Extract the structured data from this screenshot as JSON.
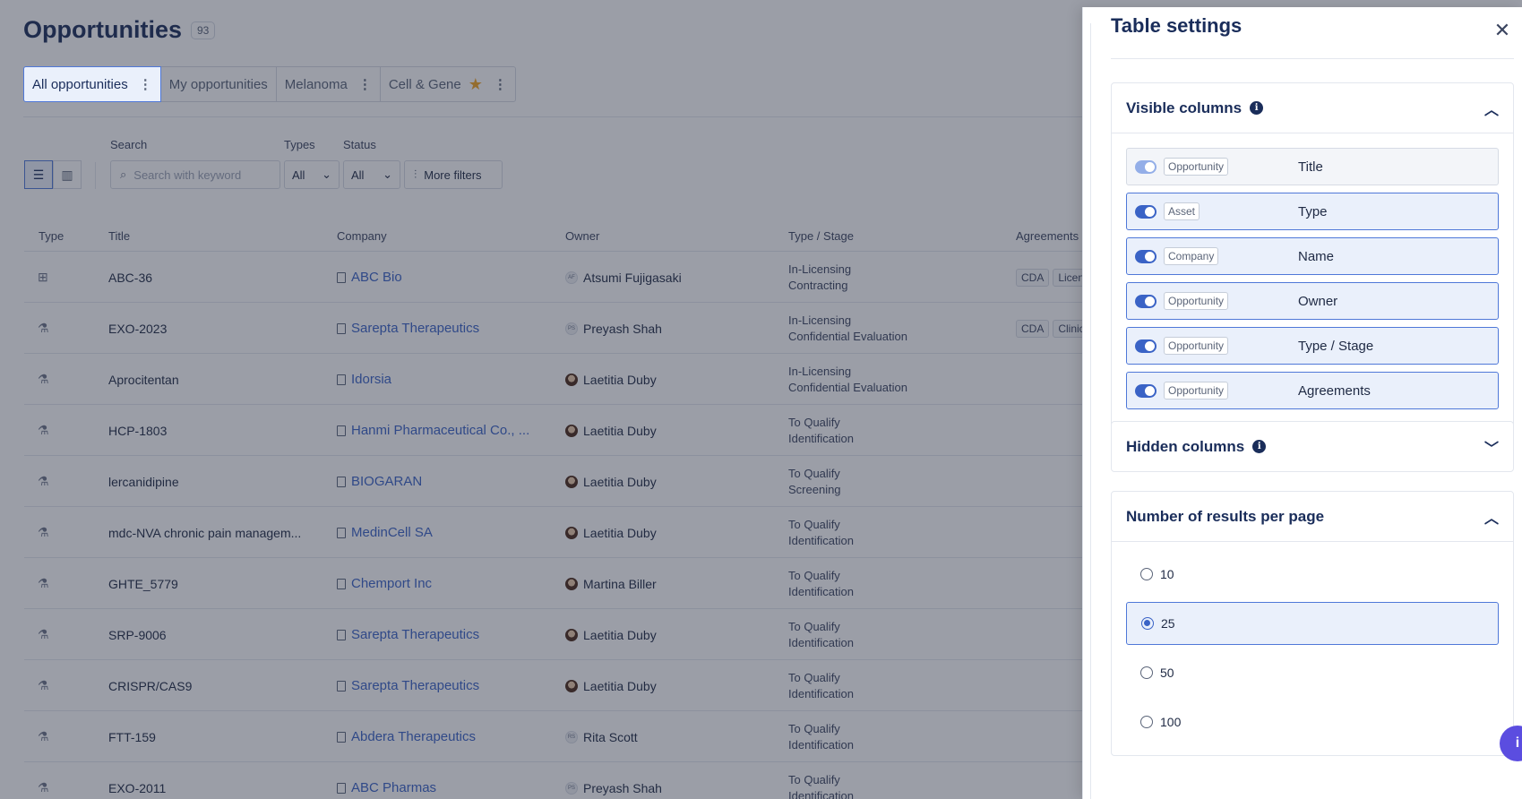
{
  "page": {
    "title": "Opportunities",
    "count": "93"
  },
  "views": [
    {
      "label": "All opportunities"
    },
    {
      "label": "My opportunities"
    },
    {
      "label": "Melanoma"
    },
    {
      "label": "Cell & Gene"
    }
  ],
  "filters": {
    "search_label": "Search",
    "search_placeholder": "Search with keyword",
    "types_label": "Types",
    "types_value": "All",
    "status_label": "Status",
    "status_value": "All",
    "more_filters": "More filters"
  },
  "table": {
    "headers": {
      "type": "Type",
      "title": "Title",
      "company": "Company",
      "owner": "Owner",
      "type_stage": "Type / Stage",
      "agreements": "Agreements"
    },
    "rows": [
      {
        "icon": "grid-icon",
        "title": "ABC-36",
        "company": "ABC Bio",
        "owner": "Atsumi Fujigasaki",
        "owner_initials": "AF",
        "type": "In-Licensing",
        "stage": "Contracting",
        "agreements": [
          "CDA",
          "Licens"
        ]
      },
      {
        "icon": "flask-icon",
        "title": "EXO-2023",
        "company": "Sarepta Therapeutics",
        "owner": "Preyash Shah",
        "owner_initials": "PS",
        "type": "In-Licensing",
        "stage": "Confidential Evaluation",
        "agreements": [
          "CDA",
          "Clinica"
        ]
      },
      {
        "icon": "flask-icon",
        "title": "Aprocitentan",
        "company": "Idorsia",
        "owner": "Laetitia Duby",
        "owner_initials": "",
        "type": "In-Licensing",
        "stage": "Confidential Evaluation",
        "agreements": []
      },
      {
        "icon": "flask-icon",
        "title": "HCP-1803",
        "company": "Hanmi Pharmaceutical Co., ...",
        "owner": "Laetitia Duby",
        "owner_initials": "",
        "type": "To Qualify",
        "stage": "Identification",
        "agreements": []
      },
      {
        "icon": "flask-icon",
        "title": "lercanidipine",
        "company": "BIOGARAN",
        "owner": "Laetitia Duby",
        "owner_initials": "",
        "type": "To Qualify",
        "stage": "Screening",
        "agreements": []
      },
      {
        "icon": "flask-icon",
        "title": "mdc-NVA chronic pain managem...",
        "company": "MedinCell SA",
        "owner": "Laetitia Duby",
        "owner_initials": "",
        "type": "To Qualify",
        "stage": "Identification",
        "agreements": []
      },
      {
        "icon": "flask-icon",
        "title": "GHTE_5779",
        "company": "Chemport Inc",
        "owner": "Martina Biller",
        "owner_initials": "",
        "type": "To Qualify",
        "stage": "Identification",
        "agreements": []
      },
      {
        "icon": "flask-icon",
        "title": "SRP-9006",
        "company": "Sarepta Therapeutics",
        "owner": "Laetitia Duby",
        "owner_initials": "",
        "type": "To Qualify",
        "stage": "Identification",
        "agreements": []
      },
      {
        "icon": "flask-icon",
        "title": "CRISPR/CAS9",
        "company": "Sarepta Therapeutics",
        "owner": "Laetitia Duby",
        "owner_initials": "",
        "type": "To Qualify",
        "stage": "Identification",
        "agreements": []
      },
      {
        "icon": "flask-icon",
        "title": "FTT-159",
        "company": "Abdera Therapeutics",
        "owner": "Rita Scott",
        "owner_initials": "RS",
        "type": "To Qualify",
        "stage": "Identification",
        "agreements": []
      },
      {
        "icon": "flask-icon",
        "title": "EXO-2011",
        "company": "ABC Pharmas",
        "owner": "Preyash Shah",
        "owner_initials": "PS",
        "type": "To Qualify",
        "stage": "Identification",
        "agreements": []
      }
    ]
  },
  "drawer": {
    "title": "Table settings",
    "close_icon": "close-icon",
    "visible_columns": {
      "title": "Visible columns",
      "columns": [
        {
          "tag": "Opportunity",
          "name": "Title"
        },
        {
          "tag": "Asset",
          "name": "Type"
        },
        {
          "tag": "Company",
          "name": "Name"
        },
        {
          "tag": "Opportunity",
          "name": "Owner"
        },
        {
          "tag": "Opportunity",
          "name": "Type / Stage"
        },
        {
          "tag": "Opportunity",
          "name": "Agreements"
        }
      ]
    },
    "hidden_columns": {
      "title": "Hidden columns"
    },
    "results_per_page": {
      "title": "Number of results per page",
      "options": [
        "10",
        "25",
        "50",
        "100"
      ],
      "selected": "25"
    }
  },
  "colors": {
    "accent": "#3a63c6",
    "title": "#1a2d5a",
    "star": "#f2a421",
    "fab": "#5b4de0"
  }
}
